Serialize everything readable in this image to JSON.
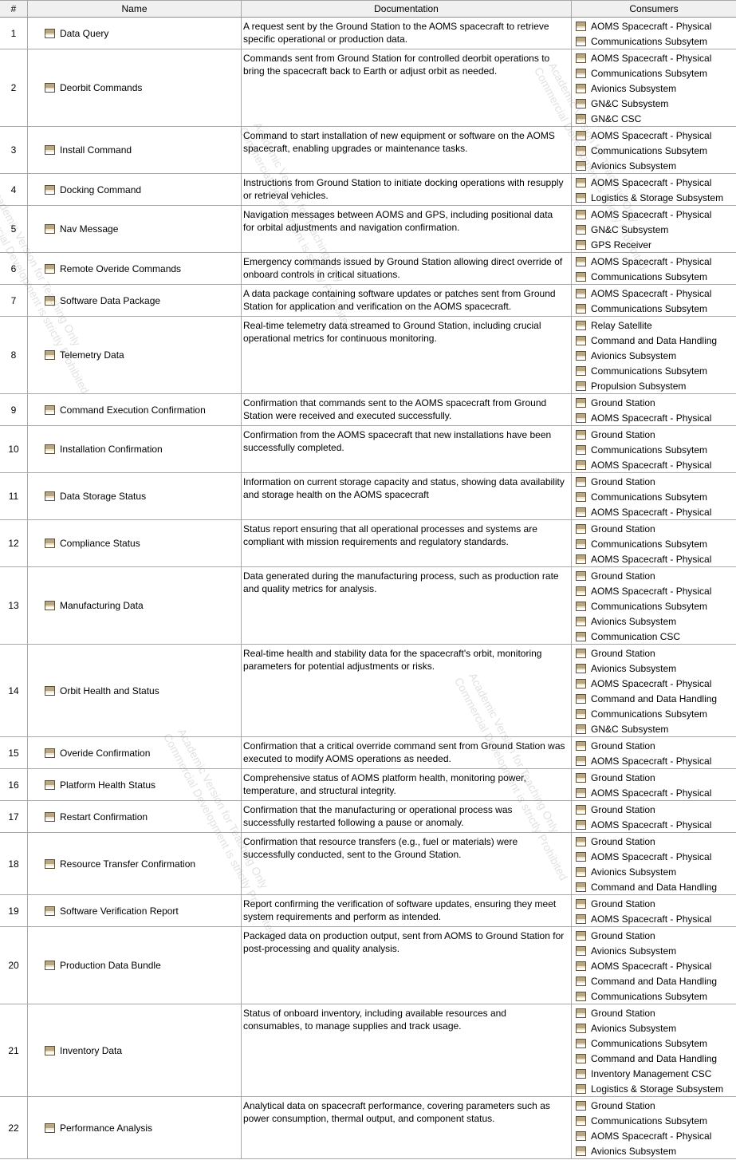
{
  "columns": {
    "num": "#",
    "name": "Name",
    "doc": "Documentation",
    "consumers": "Consumers"
  },
  "rows": [
    {
      "num": "1",
      "name": "Data Query",
      "doc": "A request sent by the Ground Station to the AOMS spacecraft to retrieve specific operational or production data.",
      "consumers": [
        "AOMS Spacecraft - Physical",
        "Communications Subsytem"
      ]
    },
    {
      "num": "2",
      "name": "Deorbit Commands",
      "doc": "Commands sent from Ground Station for controlled deorbit operations to bring the spacecraft back to Earth or adjust orbit as needed.",
      "consumers": [
        "AOMS Spacecraft - Physical",
        "Communications Subsytem",
        "Avionics Subsystem",
        "GN&C Subsystem",
        "GN&C CSC"
      ]
    },
    {
      "num": "3",
      "name": "Install Command",
      "doc": "Command to start installation of new equipment or software on the AOMS spacecraft, enabling upgrades or maintenance tasks.",
      "consumers": [
        "AOMS Spacecraft - Physical",
        "Communications Subsytem",
        "Avionics Subsystem"
      ]
    },
    {
      "num": "4",
      "name": "Docking Command",
      "doc": "Instructions from Ground Station to initiate docking operations with resupply or retrieval vehicles.",
      "consumers": [
        "AOMS Spacecraft - Physical",
        "Logistics & Storage Subsystem"
      ]
    },
    {
      "num": "5",
      "name": "Nav Message",
      "doc": "Navigation messages between AOMS and GPS, including positional data for orbital adjustments and navigation confirmation.",
      "consumers": [
        "AOMS Spacecraft - Physical",
        "GN&C Subsystem",
        "GPS Receiver"
      ]
    },
    {
      "num": "6",
      "name": "Remote Overide Commands",
      "doc": "Emergency commands issued by Ground Station allowing direct override of onboard controls in critical situations.",
      "consumers": [
        "AOMS Spacecraft - Physical",
        "Communications Subsytem"
      ]
    },
    {
      "num": "7",
      "name": "Software Data Package",
      "doc": "A data package containing software updates or patches sent from Ground Station for application and verification on the AOMS spacecraft.",
      "consumers": [
        "AOMS Spacecraft - Physical",
        "Communications Subsytem"
      ]
    },
    {
      "num": "8",
      "name": "Telemetry Data",
      "doc": "Real-time telemetry data streamed to Ground Station, including crucial operational metrics for continuous monitoring.",
      "consumers": [
        "Relay Satellite",
        "Command and Data Handling",
        "Avionics Subsystem",
        "Communications Subsytem",
        "Propulsion Subsystem"
      ]
    },
    {
      "num": "9",
      "name": "Command Execution Confirmation",
      "doc": "Confirmation that commands sent to the AOMS spacecraft from Ground Station were received and executed successfully.",
      "consumers": [
        "Ground Station",
        "AOMS Spacecraft - Physical"
      ]
    },
    {
      "num": "10",
      "name": "Installation Confirmation",
      "doc": "Confirmation from the AOMS spacecraft that new installations have been successfully completed.",
      "consumers": [
        "Ground Station",
        "Communications Subsytem",
        "AOMS Spacecraft - Physical"
      ]
    },
    {
      "num": "11",
      "name": "Data Storage Status",
      "doc": "Information on current storage capacity and status, showing data availability and storage health on the AOMS spacecraft",
      "consumers": [
        "Ground Station",
        "Communications Subsytem",
        "AOMS Spacecraft - Physical"
      ]
    },
    {
      "num": "12",
      "name": "Compliance Status",
      "doc": "Status report ensuring that all operational processes and systems are compliant with mission requirements and regulatory standards.",
      "consumers": [
        "Ground Station",
        "Communications Subsytem",
        "AOMS Spacecraft - Physical"
      ]
    },
    {
      "num": "13",
      "name": "Manufacturing Data",
      "doc": "Data generated during the manufacturing process, such as production rate and quality metrics for analysis.",
      "consumers": [
        "Ground Station",
        "AOMS Spacecraft - Physical",
        "Communications Subsytem",
        "Avionics Subsystem",
        "Communication CSC"
      ]
    },
    {
      "num": "14",
      "name": "Orbit Health and Status",
      "doc": "Real-time health and stability data for the spacecraft's orbit, monitoring parameters for potential adjustments or risks.",
      "consumers": [
        "Ground Station",
        "Avionics Subsystem",
        "AOMS Spacecraft - Physical",
        "Command and Data Handling",
        "Communications Subsytem",
        "GN&C Subsystem"
      ]
    },
    {
      "num": "15",
      "name": "Overide Confirmation",
      "doc": "Confirmation that a critical override command sent from Ground Station was executed to modify AOMS operations as needed.",
      "consumers": [
        "Ground Station",
        "AOMS Spacecraft - Physical"
      ]
    },
    {
      "num": "16",
      "name": "Platform Health Status",
      "doc": "Comprehensive status of AOMS platform health, monitoring power, temperature, and structural integrity.",
      "consumers": [
        "Ground Station",
        "AOMS Spacecraft - Physical"
      ]
    },
    {
      "num": "17",
      "name": "Restart Confirmation",
      "doc": "Confirmation that the manufacturing or operational process was successfully restarted following a pause or anomaly.",
      "consumers": [
        "Ground Station",
        "AOMS Spacecraft - Physical"
      ]
    },
    {
      "num": "18",
      "name": "Resource Transfer Confirmation",
      "doc": "Confirmation that resource transfers (e.g., fuel or materials) were successfully conducted, sent to the Ground Station.",
      "consumers": [
        "Ground Station",
        "AOMS Spacecraft - Physical",
        "Avionics Subsystem",
        "Command and Data Handling"
      ]
    },
    {
      "num": "19",
      "name": "Software Verification Report",
      "doc": "Report confirming the verification of software updates, ensuring they meet system requirements and perform as intended.",
      "consumers": [
        "Ground Station",
        "AOMS Spacecraft - Physical"
      ]
    },
    {
      "num": "20",
      "name": "Production Data Bundle",
      "doc": "Packaged data on production output, sent from AOMS to Ground Station for post-processing and quality analysis.",
      "consumers": [
        "Ground Station",
        "Avionics Subsystem",
        "AOMS Spacecraft - Physical",
        "Command and Data Handling",
        "Communications Subsytem"
      ]
    },
    {
      "num": "21",
      "name": "Inventory Data",
      "doc": "Status of onboard inventory, including available resources and consumables, to manage supplies and track usage.",
      "consumers": [
        "Ground Station",
        "Avionics Subsystem",
        "Communications Subsytem",
        "Command and Data Handling",
        "Inventory Management CSC",
        "Logistics & Storage Subsystem"
      ]
    },
    {
      "num": "22",
      "name": "Performance Analysis",
      "doc": "Analytical data on spacecraft performance, covering parameters such as power consumption, thermal output, and component status.",
      "consumers": [
        "Ground Station",
        "Communications Subsytem",
        "AOMS Spacecraft - Physical",
        "Avionics Subsystem"
      ]
    }
  ],
  "watermark": [
    "Academic Version for Teaching Only",
    "Commercial Development is strictly Prohibited"
  ]
}
